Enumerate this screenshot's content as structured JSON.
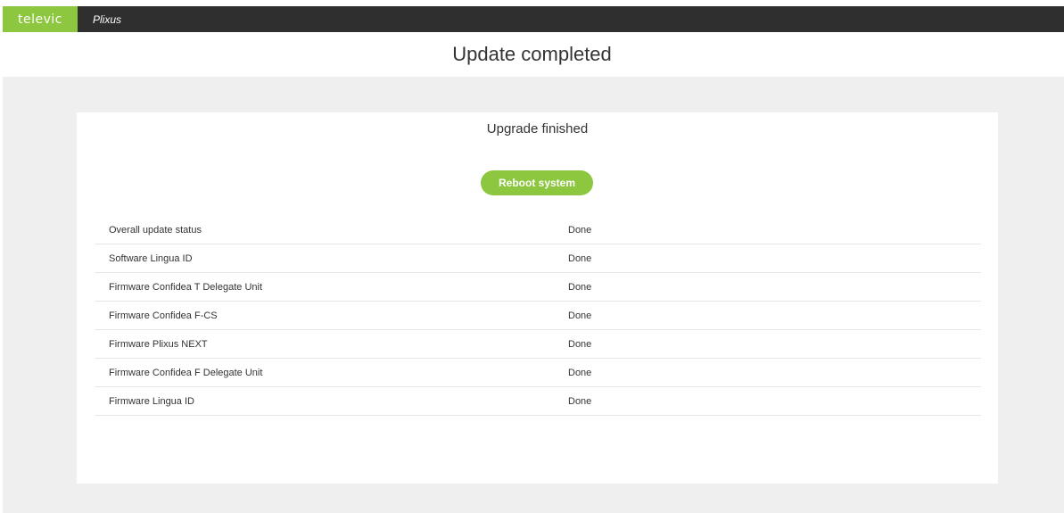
{
  "header": {
    "brand": "televic",
    "product": "Plixus"
  },
  "page": {
    "title": "Update completed"
  },
  "card": {
    "title": "Upgrade finished",
    "reboot_label": "Reboot system"
  },
  "status_rows": [
    {
      "name": "Overall update status",
      "status": "Done"
    },
    {
      "name": "Software Lingua ID",
      "status": "Done"
    },
    {
      "name": "Firmware Confidea T Delegate Unit",
      "status": "Done"
    },
    {
      "name": "Firmware Confidea F-CS",
      "status": "Done"
    },
    {
      "name": "Firmware Plixus NEXT",
      "status": "Done"
    },
    {
      "name": "Firmware Confidea F Delegate Unit",
      "status": "Done"
    },
    {
      "name": "Firmware Lingua ID",
      "status": "Done"
    }
  ],
  "colors": {
    "accent": "#8dc63f",
    "topbar": "#2f2f2f",
    "background": "#efefef"
  }
}
